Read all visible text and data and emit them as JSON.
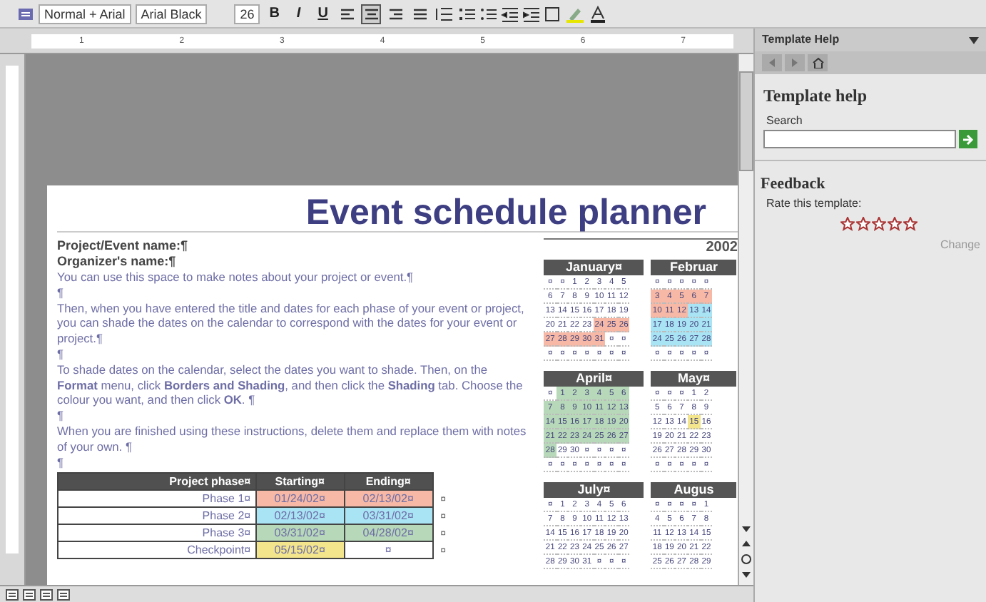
{
  "toolbar": {
    "style": "Normal + Arial",
    "font": "Arial Black",
    "size": "26",
    "bold": "B",
    "italic": "I",
    "underline": "U",
    "align_buttons": [
      {
        "selected": false
      },
      {
        "selected": true
      },
      {
        "selected": false
      },
      {
        "selected": false
      }
    ]
  },
  "ruler": {
    "labels": [
      "1",
      "2",
      "3",
      "4",
      "5",
      "6",
      "7"
    ]
  },
  "document": {
    "title": "Event schedule planner",
    "fields": [
      "Project/Event name:¶",
      "Organizer's name:¶"
    ],
    "paragraphs": [
      "You can use this space to make notes about your project or event.¶",
      "¶",
      "Then, when you have entered the title and dates for each phase of your event or project, you can shade the dates on the calendar to correspond with the dates for your event or project.¶",
      "¶",
      "To shade dates on the calendar, select the dates you want to shade. Then, on the **Format** menu, click **Borders and Shading**, and then click the **Shading** tab.  Choose the colour you want, and then click **OK**. ¶",
      "¶",
      "When you are finished using these instructions, delete them and replace them with notes of your own. ¶",
      "¶"
    ],
    "table": {
      "columns": [
        "Project phase¤",
        "Starting¤",
        "Ending¤"
      ],
      "rows": [
        {
          "cells": [
            "Phase 1¤",
            "01/24/02¤",
            "02/13/02¤"
          ],
          "color": "#f7b9a6",
          "ending_shaded": true,
          "mark": "¤"
        },
        {
          "cells": [
            "Phase 2¤",
            "02/13/02¤",
            "03/31/02¤"
          ],
          "color": "#a9e4f5",
          "ending_shaded": true,
          "mark": "¤"
        },
        {
          "cells": [
            "Phase 3¤",
            "03/31/02¤",
            "04/28/02¤"
          ],
          "color": "#b7d8b9",
          "ending_shaded": true,
          "mark": "¤"
        },
        {
          "cells": [
            "Checkpoint¤",
            "05/15/02¤",
            "¤"
          ],
          "color": "#f3e58c",
          "ending_shaded": false,
          "mark": "¤"
        }
      ]
    },
    "calendar": {
      "year": "2002",
      "months": [
        {
          "name": "January¤",
          "weeks": [
            [
              "¤",
              "¤",
              "1",
              "2",
              "3",
              "4",
              "5"
            ],
            [
              "6",
              "7",
              "8",
              "9",
              "10",
              "11",
              "12"
            ],
            [
              "13",
              "14",
              "15",
              "16",
              "17",
              "18",
              "19"
            ],
            [
              "20",
              "21",
              "22",
              "23",
              {
                "day": "24",
                "color": "#f7b9a6"
              },
              {
                "day": "25",
                "color": "#f7b9a6"
              },
              {
                "day": "26",
                "color": "#f7b9a6"
              }
            ],
            [
              {
                "day": "27",
                "color": "#f7b9a6"
              },
              {
                "day": "28",
                "color": "#f7b9a6"
              },
              {
                "day": "29",
                "color": "#f7b9a6"
              },
              {
                "day": "30",
                "color": "#f7b9a6"
              },
              {
                "day": "31",
                "color": "#f7b9a6"
              },
              "¤",
              "¤"
            ],
            [
              "¤",
              "¤",
              "¤",
              "¤",
              "¤",
              "¤",
              "¤"
            ]
          ]
        },
        {
          "name": "Februar",
          "weeks": [
            [
              "¤",
              "¤",
              "¤",
              "¤",
              "¤"
            ],
            [
              {
                "day": "3",
                "color": "#f7b9a6"
              },
              {
                "day": "4",
                "color": "#f7b9a6"
              },
              {
                "day": "5",
                "color": "#f7b9a6"
              },
              {
                "day": "6",
                "color": "#f7b9a6"
              },
              {
                "day": "7",
                "color": "#f7b9a6"
              }
            ],
            [
              {
                "day": "10",
                "color": "#f7b9a6"
              },
              {
                "day": "11",
                "color": "#f7b9a6"
              },
              {
                "day": "12",
                "color": "#f7b9a6"
              },
              {
                "day": "13",
                "color": "#a9e4f5"
              },
              {
                "day": "14",
                "color": "#a9e4f5"
              }
            ],
            [
              {
                "day": "17",
                "color": "#a9e4f5"
              },
              {
                "day": "18",
                "color": "#a9e4f5"
              },
              {
                "day": "19",
                "color": "#a9e4f5"
              },
              {
                "day": "20",
                "color": "#a9e4f5"
              },
              {
                "day": "21",
                "color": "#a9e4f5"
              }
            ],
            [
              {
                "day": "24",
                "color": "#a9e4f5"
              },
              {
                "day": "25",
                "color": "#a9e4f5"
              },
              {
                "day": "26",
                "color": "#a9e4f5"
              },
              {
                "day": "27",
                "color": "#a9e4f5"
              },
              {
                "day": "28",
                "color": "#a9e4f5"
              }
            ],
            [
              "¤",
              "¤",
              "¤",
              "¤",
              "¤"
            ]
          ]
        },
        {
          "name": "April¤",
          "weeks": [
            [
              "¤",
              {
                "day": "1",
                "color": "#b7d8b9"
              },
              {
                "day": "2",
                "color": "#b7d8b9"
              },
              {
                "day": "3",
                "color": "#b7d8b9"
              },
              {
                "day": "4",
                "color": "#b7d8b9"
              },
              {
                "day": "5",
                "color": "#b7d8b9"
              },
              {
                "day": "6",
                "color": "#b7d8b9"
              }
            ],
            [
              {
                "day": "7",
                "color": "#b7d8b9"
              },
              {
                "day": "8",
                "color": "#b7d8b9"
              },
              {
                "day": "9",
                "color": "#b7d8b9"
              },
              {
                "day": "10",
                "color": "#b7d8b9"
              },
              {
                "day": "11",
                "color": "#b7d8b9"
              },
              {
                "day": "12",
                "color": "#b7d8b9"
              },
              {
                "day": "13",
                "color": "#b7d8b9"
              }
            ],
            [
              {
                "day": "14",
                "color": "#b7d8b9"
              },
              {
                "day": "15",
                "color": "#b7d8b9"
              },
              {
                "day": "16",
                "color": "#b7d8b9"
              },
              {
                "day": "17",
                "color": "#b7d8b9"
              },
              {
                "day": "18",
                "color": "#b7d8b9"
              },
              {
                "day": "19",
                "color": "#b7d8b9"
              },
              {
                "day": "20",
                "color": "#b7d8b9"
              }
            ],
            [
              {
                "day": "21",
                "color": "#b7d8b9"
              },
              {
                "day": "22",
                "color": "#b7d8b9"
              },
              {
                "day": "23",
                "color": "#b7d8b9"
              },
              {
                "day": "24",
                "color": "#b7d8b9"
              },
              {
                "day": "25",
                "color": "#b7d8b9"
              },
              {
                "day": "26",
                "color": "#b7d8b9"
              },
              {
                "day": "27",
                "color": "#b7d8b9"
              }
            ],
            [
              {
                "day": "28",
                "color": "#b7d8b9"
              },
              "29",
              "30",
              "¤",
              "¤",
              "¤",
              "¤"
            ],
            [
              "¤",
              "¤",
              "¤",
              "¤",
              "¤",
              "¤",
              "¤"
            ]
          ]
        },
        {
          "name": "May¤",
          "weeks": [
            [
              "¤",
              "¤",
              "¤",
              "1",
              "2"
            ],
            [
              "5",
              "6",
              "7",
              "8",
              "9"
            ],
            [
              "12",
              "13",
              "14",
              {
                "day": "15",
                "color": "#f3e58c"
              },
              "16"
            ],
            [
              "19",
              "20",
              "21",
              "22",
              "23"
            ],
            [
              "26",
              "27",
              "28",
              "29",
              "30"
            ],
            [
              "¤",
              "¤",
              "¤",
              "¤",
              "¤"
            ]
          ]
        },
        {
          "name": "July¤",
          "weeks": [
            [
              "¤",
              "1",
              "2",
              "3",
              "4",
              "5",
              "6"
            ],
            [
              "7",
              "8",
              "9",
              "10",
              "11",
              "12",
              "13"
            ],
            [
              "14",
              "15",
              "16",
              "17",
              "18",
              "19",
              "20"
            ],
            [
              "21",
              "22",
              "23",
              "24",
              "25",
              "26",
              "27"
            ],
            [
              "28",
              "29",
              "30",
              "31",
              "¤",
              "¤",
              "¤"
            ]
          ]
        },
        {
          "name": "Augus",
          "weeks": [
            [
              "¤",
              "¤",
              "¤",
              "¤",
              "1"
            ],
            [
              "4",
              "5",
              "6",
              "7",
              "8"
            ],
            [
              "11",
              "12",
              "13",
              "14",
              "15"
            ],
            [
              "18",
              "19",
              "20",
              "21",
              "22"
            ],
            [
              "25",
              "26",
              "27",
              "28",
              "29"
            ]
          ]
        }
      ]
    }
  },
  "task_pane": {
    "title": "Template Help",
    "heading": "Template help",
    "search": {
      "label": "Search"
    },
    "feedback": {
      "heading": "Feedback",
      "prompt": "Rate this template:",
      "stars": 0,
      "link": "Change"
    }
  }
}
